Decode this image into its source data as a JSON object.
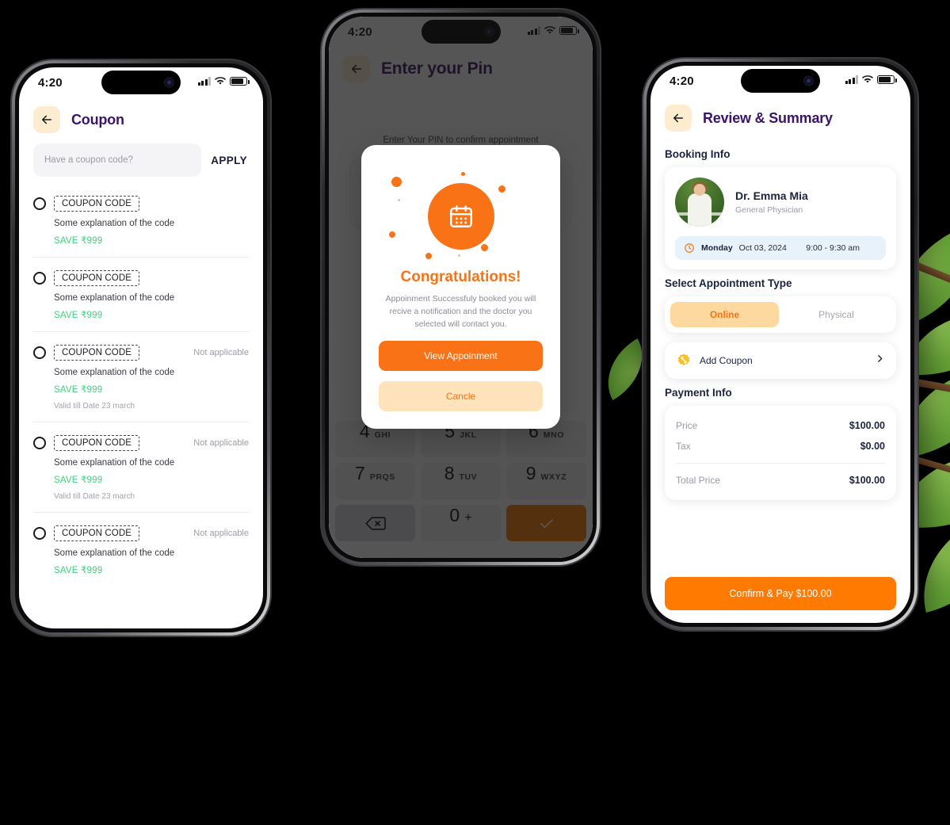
{
  "status_bar": {
    "time": "4:20"
  },
  "phone_coupon": {
    "header": {
      "title": "Coupon",
      "back_icon": "arrow-left-icon"
    },
    "search": {
      "placeholder": "Have a coupon code?",
      "value": "",
      "apply_label": "APPLY"
    },
    "coupons": [
      {
        "code": "COUPON CODE",
        "explanation": "Some explanation of the code",
        "save": "SAVE ₹999",
        "valid": "",
        "status": ""
      },
      {
        "code": "COUPON CODE",
        "explanation": "Some explanation of the code",
        "save": "SAVE ₹999",
        "valid": "",
        "status": ""
      },
      {
        "code": "COUPON CODE",
        "explanation": "Some explanation of the code",
        "save": "SAVE ₹999",
        "valid": "Valid till Date 23 march",
        "status": "Not applicable"
      },
      {
        "code": "COUPON CODE",
        "explanation": "Some explanation of the code",
        "save": "SAVE ₹999",
        "valid": "Valid till Date 23 march",
        "status": "Not applicable"
      },
      {
        "code": "COUPON CODE",
        "explanation": "Some explanation of the code",
        "save": "SAVE ₹999",
        "valid": "",
        "status": "Not applicable"
      }
    ]
  },
  "phone_pin": {
    "header": {
      "title": "Enter your Pin",
      "back_icon": "arrow-left-icon"
    },
    "subtitle": "Enter Your PIN to confirm appointment",
    "keypad": [
      {
        "num": "4",
        "letters": "GHI"
      },
      {
        "num": "5",
        "letters": "JKL"
      },
      {
        "num": "6",
        "letters": "MNO"
      },
      {
        "num": "7",
        "letters": "PRQS"
      },
      {
        "num": "8",
        "letters": "TUV"
      },
      {
        "num": "9",
        "letters": "WXYZ"
      }
    ],
    "key_backspace_icon": "backspace-icon",
    "key_zero": "0",
    "key_zero_alt": "+",
    "key_confirm_icon": "check-icon",
    "modal": {
      "badge_icon": "calendar-icon",
      "title": "Congratulations!",
      "description": "Appoinment Successfuly booked you will recive a notification and the doctor you selected will contact you.",
      "primary_label": "View Appoinment",
      "secondary_label": "Cancle"
    }
  },
  "phone_review": {
    "header": {
      "title": "Review & Summary",
      "back_icon": "arrow-left-icon"
    },
    "booking_info_label": "Booking Info",
    "doctor": {
      "name": "Dr. Emma Mia",
      "specialty": "General Physician",
      "avatar": "doctor-photo"
    },
    "slot": {
      "clock_icon": "clock-icon",
      "day": "Monday",
      "date": "Oct 03, 2024",
      "time": "9:00 - 9:30 am"
    },
    "appointment_type_label": "Select Appointment Type",
    "appointment_types": [
      {
        "label": "Online",
        "active": true
      },
      {
        "label": "Physical",
        "active": false
      }
    ],
    "coupon_row": {
      "icon": "percent-badge-icon",
      "label": "Add Coupon",
      "chevron": "chevron-right-icon"
    },
    "payment_info_label": "Payment Info",
    "payment_rows": [
      {
        "key": "Price",
        "value": "$100.00"
      },
      {
        "key": "Tax",
        "value": "$0.00"
      }
    ],
    "total": {
      "key": "Total Price",
      "value": "$100.00"
    },
    "confirm_label": "Confirm & Pay $100.00"
  },
  "colors": {
    "accent_orange": "#ff7a00",
    "accent_orange_soft": "#fdd9a0",
    "title_purple": "#3b1368",
    "save_green": "#3fd07f",
    "navy": "#1c2340"
  }
}
